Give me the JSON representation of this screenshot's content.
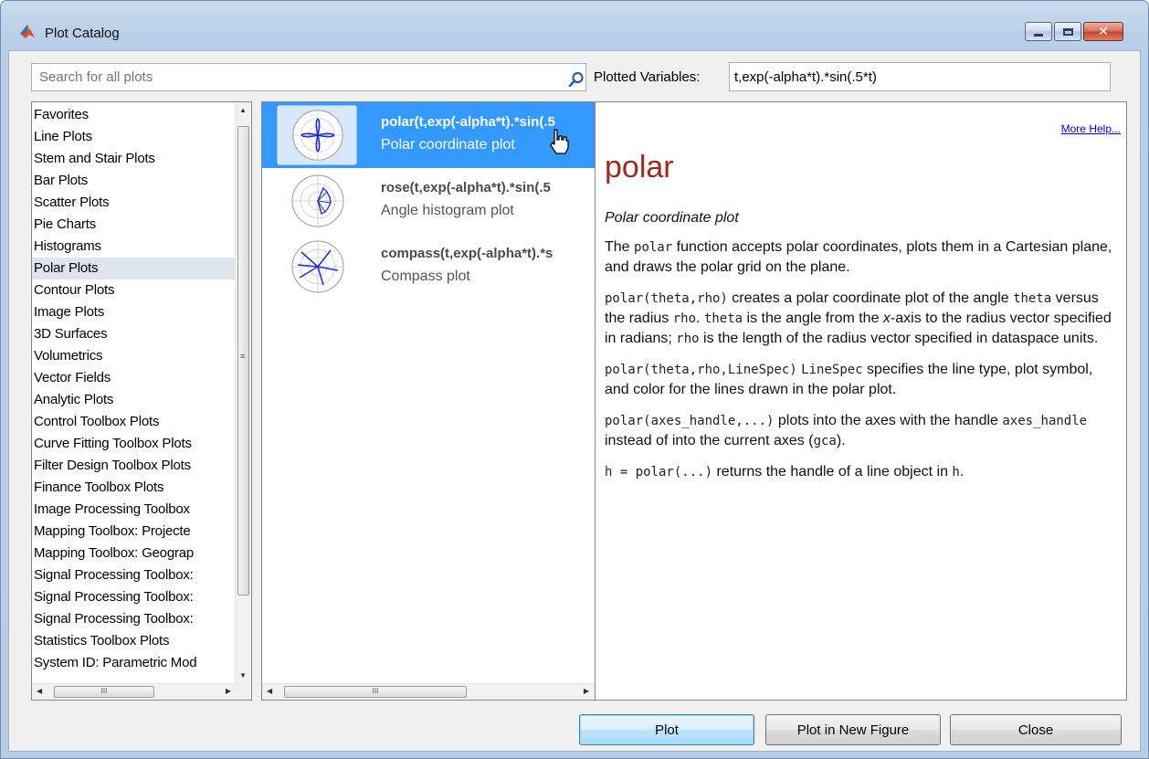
{
  "window": {
    "title": "Plot Catalog",
    "controls": {
      "minimize": "minimize",
      "maximize": "maximize",
      "close": "✕"
    }
  },
  "search": {
    "placeholder": "Search for all plots",
    "value": ""
  },
  "plotted_variables": {
    "label": "Plotted Variables:",
    "value": "t,exp(-alpha*t).*sin(.5*t)"
  },
  "categories": {
    "selected": "Polar Plots",
    "items": [
      "Favorites",
      "Line Plots",
      "Stem and Stair Plots",
      "Bar Plots",
      "Scatter Plots",
      "Pie Charts",
      "Histograms",
      "Polar Plots",
      "Contour Plots",
      "Image Plots",
      "3D Surfaces",
      "Volumetrics",
      "Vector Fields",
      "Analytic Plots",
      "Control Toolbox Plots",
      "Curve Fitting Toolbox Plots",
      "Filter Design Toolbox Plots",
      "Finance Toolbox Plots",
      "Image Processing Toolbox",
      "Mapping Toolbox: Projecte",
      "Mapping Toolbox: Geograp",
      "Signal Processing Toolbox:",
      "Signal Processing Toolbox:",
      "Signal Processing Toolbox:",
      "Statistics Toolbox Plots",
      "System ID: Parametric Mod"
    ]
  },
  "plots": [
    {
      "command": "polar(t,exp(-alpha*t).*sin(.5",
      "description": "Polar coordinate plot",
      "icon": "polar-plot-icon",
      "selected": true
    },
    {
      "command": "rose(t,exp(-alpha*t).*sin(.5",
      "description": "Angle histogram plot",
      "icon": "rose-plot-icon",
      "selected": false
    },
    {
      "command": "compass(t,exp(-alpha*t).*s",
      "description": "Compass plot",
      "icon": "compass-plot-icon",
      "selected": false
    }
  ],
  "help": {
    "more_help": "More Help...",
    "title": "polar",
    "subtitle": "Polar coordinate plot",
    "p1": {
      "a": "The ",
      "code1": "polar",
      "b": " function accepts polar coordinates, plots them in a Cartesian plane, and draws the polar grid on the plane."
    },
    "p2": {
      "code1": "polar(theta,rho)",
      "a": " creates a polar coordinate plot of the angle ",
      "code2": "theta",
      "b": " versus the radius ",
      "code3": "rho",
      "c": ". ",
      "code4": "theta",
      "d": " is the angle from the ",
      "x": "x",
      "e": "-axis to the radius vector specified in radians; ",
      "code5": "rho",
      "f": " is the length of the radius vector specified in dataspace units."
    },
    "p3": {
      "code1": "polar(theta,rho,LineSpec)",
      "a": " ",
      "code2": "LineSpec",
      "b": " specifies the line type, plot symbol, and color for the lines drawn in the polar plot."
    },
    "p4": {
      "code1": "polar(axes_handle,...)",
      "a": " plots into the axes with the handle ",
      "code2": "axes_handle",
      "b": " instead of into the current axes (",
      "gca": "gca",
      "c": ")."
    },
    "p5": {
      "code1": "h = polar(...)",
      "a": " returns the handle of a line object in ",
      "code2": "h",
      "b": "."
    }
  },
  "buttons": {
    "plot": "Plot",
    "plot_new_figure": "Plot in New Figure",
    "close": "Close"
  },
  "scrollbar_grip": "III",
  "colors": {
    "selection": "#3399ff",
    "help_title": "#a0281e",
    "link": "#0000ee"
  }
}
